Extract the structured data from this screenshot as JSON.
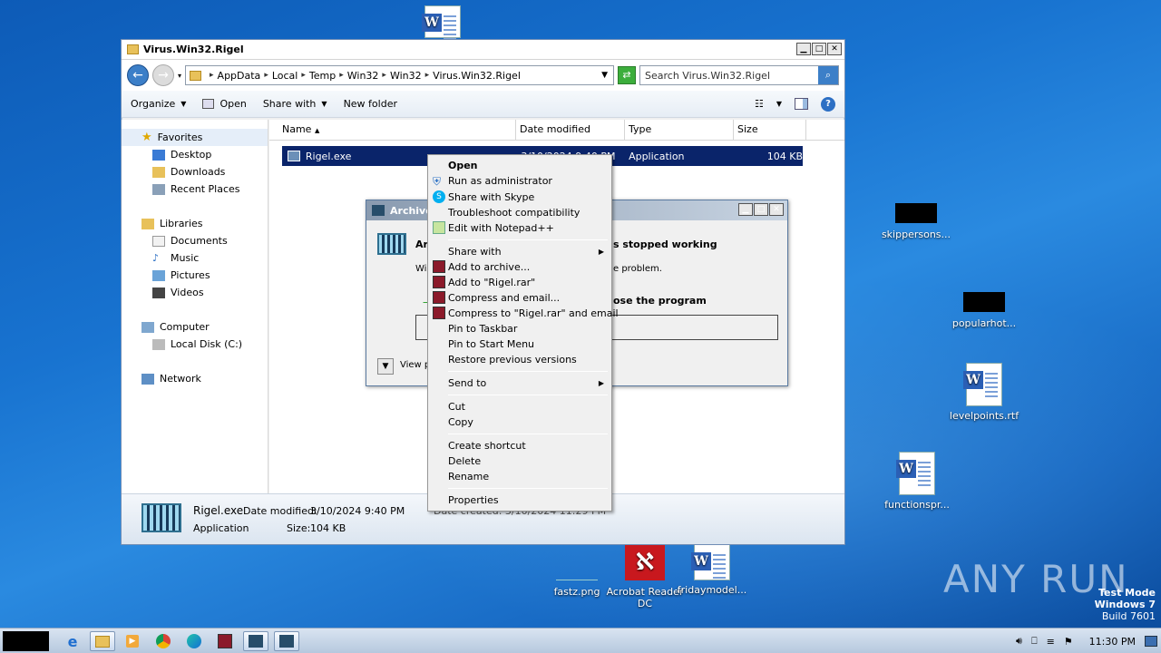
{
  "desktop": {
    "icons": [
      {
        "label": "skippersons...",
        "kind": "redacted"
      },
      {
        "label": "popularhot...",
        "kind": "redacted"
      },
      {
        "label": "levelpoints.rtf",
        "kind": "word"
      },
      {
        "label": "functionspr...",
        "kind": "word"
      },
      {
        "label": "fastz.png",
        "kind": "image"
      },
      {
        "label": "Acrobat Reader DC",
        "kind": "acrobat"
      },
      {
        "label": "fridaymodel...",
        "kind": "word"
      }
    ],
    "watermark": "ANY RUN",
    "test_mode": {
      "line1": "Test Mode",
      "line2": "Windows 7",
      "line3": "Build 7601"
    }
  },
  "explorer": {
    "title": "Virus.Win32.Rigel",
    "breadcrumb": [
      "AppData",
      "Local",
      "Temp",
      "Win32",
      "Win32",
      "Virus.Win32.Rigel"
    ],
    "search_placeholder": "Search Virus.Win32.Rigel",
    "toolbar": {
      "organize": "Organize",
      "open": "Open",
      "share_with": "Share with",
      "new_folder": "New folder"
    },
    "nav": {
      "favorites": "Favorites",
      "desktop": "Desktop",
      "downloads": "Downloads",
      "recent": "Recent Places",
      "libraries": "Libraries",
      "documents": "Documents",
      "music": "Music",
      "pictures": "Pictures",
      "videos": "Videos",
      "computer": "Computer",
      "local_disk": "Local Disk (C:)",
      "network": "Network"
    },
    "columns": {
      "name": "Name",
      "date": "Date modified",
      "type": "Type",
      "size": "Size"
    },
    "file": {
      "name": "Rigel.exe",
      "date": "3/10/2024 9:40 PM",
      "type": "Application",
      "size": "104 KB"
    },
    "details": {
      "name": "Rigel.exe",
      "modified_label": "Date modified:",
      "modified": "3/10/2024 9:40 PM",
      "type": "Application",
      "size_label": "Size:",
      "size": "104 KB",
      "created_partial": "Date created: 3/10/2024 11:29 PM"
    }
  },
  "dialog": {
    "title": "Archivo",
    "heading_partial": "Ar",
    "heading_tail": "s stopped working",
    "body_partial": "Wi",
    "body_tail": "e problem.",
    "close_tail": "ose the program",
    "view_partial": "View p"
  },
  "context_menu": {
    "items": [
      {
        "label": "Open",
        "bold": true
      },
      {
        "label": "Run as administrator"
      },
      {
        "label": "Share with Skype"
      },
      {
        "label": "Troubleshoot compatibility"
      },
      {
        "label": "Edit with Notepad++"
      },
      {
        "label": "Share with",
        "submenu": true
      },
      {
        "label": "Add to archive..."
      },
      {
        "label": "Add to \"Rigel.rar\""
      },
      {
        "label": "Compress and email..."
      },
      {
        "label": "Compress to \"Rigel.rar\" and email"
      },
      {
        "label": "Pin to Taskbar"
      },
      {
        "label": "Pin to Start Menu"
      },
      {
        "label": "Restore previous versions"
      },
      {
        "label": "Send to",
        "submenu": true
      },
      {
        "label": "Cut"
      },
      {
        "label": "Copy"
      },
      {
        "label": "Create shortcut"
      },
      {
        "label": "Delete"
      },
      {
        "label": "Rename"
      },
      {
        "label": "Properties"
      }
    ]
  },
  "taskbar": {
    "clock": "11:30 PM"
  }
}
